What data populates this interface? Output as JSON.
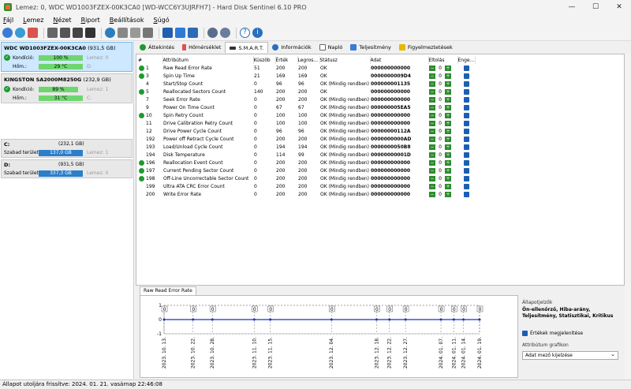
{
  "window": {
    "title": "Lemez: 0, WDC WD1003FZEX-00K3CA0 [WD-WCC6Y3UJRFH7]  -  Hard Disk Sentinel 6.10 PRO",
    "minimize": "—",
    "maximize": "☐",
    "close": "✕"
  },
  "menu": [
    "Fájl",
    "Lemez",
    "Nézet",
    "Riport",
    "Beállítások",
    "Súgó"
  ],
  "toolbar": {
    "icons": [
      "refresh-icon",
      "refresh-all-icon",
      "tools-icon",
      "hdd-icon",
      "hdd-test-icon",
      "hdd-info-icon",
      "hdd-remove-icon",
      "network-icon",
      "upload-icon",
      "print-icon",
      "copy-icon",
      "report-icon",
      "email-icon",
      "email-send-icon",
      "gear-icon",
      "gear-alt-icon",
      "help-icon",
      "info-icon"
    ]
  },
  "disks": [
    {
      "name": "WDC WD1003FZEX-00K3CA0",
      "cap": "(931,5 GB)",
      "kond_label": "Kondíció:",
      "kond": "100 %",
      "lemez": "Lemez: 0",
      "hom_label": "Hőm.:",
      "hom": "29 °C",
      "drive": "D:"
    },
    {
      "name": "KINGSTON SA2000M8250G",
      "cap": "(232,9 GB)",
      "kond_label": "Kondíció:",
      "kond": "89 %",
      "lemez": "Lemez: 1",
      "hom_label": "Hőm.:",
      "hom": "31 °C",
      "drive": "C:"
    }
  ],
  "volumes": [
    {
      "name": "C:",
      "cap": "(232,1 GB)",
      "free_label": "Szabad terület",
      "free": "137,0 GB",
      "lemez": "Lemez: 1"
    },
    {
      "name": "D:",
      "cap": "(931,5 GB)",
      "free_label": "Szabad terület",
      "free": "337,3 GB",
      "lemez": "Lemez: 0"
    }
  ],
  "tabs": [
    "Áttekintés",
    "Hőmérséklet",
    "S.M.A.R.T.",
    "Információk",
    "Napló",
    "Teljesítmény",
    "Figyelmeztetések"
  ],
  "table": {
    "headers": [
      "#",
      "Attribútum",
      "Küszöb",
      "Érték",
      "Legros...",
      "Státusz",
      "Adat",
      "Eltolás",
      "Enge..."
    ],
    "rows": [
      {
        "ok": true,
        "id": "1",
        "attr": "Raw Read Error Rate",
        "thr": "51",
        "val": "200",
        "worst": "200",
        "status": "OK",
        "data": "000000000000",
        "shift": "0"
      },
      {
        "ok": true,
        "id": "3",
        "attr": "Spin Up Time",
        "thr": "21",
        "val": "169",
        "worst": "169",
        "status": "OK",
        "data": "0000000009D4",
        "shift": "0"
      },
      {
        "ok": false,
        "id": "4",
        "attr": "Start/Stop Count",
        "thr": "0",
        "val": "96",
        "worst": "96",
        "status": "OK (Mindig rendben)",
        "data": "000000001135",
        "shift": "0"
      },
      {
        "ok": true,
        "id": "5",
        "attr": "Reallocated Sectors Count",
        "thr": "140",
        "val": "200",
        "worst": "200",
        "status": "OK",
        "data": "000000000000",
        "shift": "0"
      },
      {
        "ok": false,
        "id": "7",
        "attr": "Seek Error Rate",
        "thr": "0",
        "val": "200",
        "worst": "200",
        "status": "OK (Mindig rendben)",
        "data": "000000000000",
        "shift": "0"
      },
      {
        "ok": false,
        "id": "9",
        "attr": "Power On Time Count",
        "thr": "0",
        "val": "67",
        "worst": "67",
        "status": "OK (Mindig rendben)",
        "data": "000000005EA5",
        "shift": "0"
      },
      {
        "ok": true,
        "id": "10",
        "attr": "Spin Retry Count",
        "thr": "0",
        "val": "100",
        "worst": "100",
        "status": "OK (Mindig rendben)",
        "data": "000000000000",
        "shift": "0"
      },
      {
        "ok": false,
        "id": "11",
        "attr": "Drive Calibration Retry Count",
        "thr": "0",
        "val": "100",
        "worst": "100",
        "status": "OK (Mindig rendben)",
        "data": "000000000000",
        "shift": "0"
      },
      {
        "ok": false,
        "id": "12",
        "attr": "Drive Power Cycle Count",
        "thr": "0",
        "val": "96",
        "worst": "96",
        "status": "OK (Mindig rendben)",
        "data": "00000000112A",
        "shift": "0"
      },
      {
        "ok": false,
        "id": "192",
        "attr": "Power off Retract Cycle Count",
        "thr": "0",
        "val": "200",
        "worst": "200",
        "status": "OK (Mindig rendben)",
        "data": "0000000000AD",
        "shift": "0"
      },
      {
        "ok": false,
        "id": "193",
        "attr": "Load/Unload Cycle Count",
        "thr": "0",
        "val": "194",
        "worst": "194",
        "status": "OK (Mindig rendben)",
        "data": "0000000050B8",
        "shift": "0"
      },
      {
        "ok": false,
        "id": "194",
        "attr": "Disk Temperature",
        "thr": "0",
        "val": "114",
        "worst": "99",
        "status": "OK (Mindig rendben)",
        "data": "00000000001D",
        "shift": "0"
      },
      {
        "ok": true,
        "id": "196",
        "attr": "Reallocation Event Count",
        "thr": "0",
        "val": "200",
        "worst": "200",
        "status": "OK (Mindig rendben)",
        "data": "000000000000",
        "shift": "0"
      },
      {
        "ok": true,
        "id": "197",
        "attr": "Current Pending Sector Count",
        "thr": "0",
        "val": "200",
        "worst": "200",
        "status": "OK (Mindig rendben)",
        "data": "000000000000",
        "shift": "0"
      },
      {
        "ok": true,
        "id": "198",
        "attr": "Off-Line Uncorrectable Sector Count",
        "thr": "0",
        "val": "200",
        "worst": "200",
        "status": "OK (Mindig rendben)",
        "data": "000000000000",
        "shift": "0"
      },
      {
        "ok": false,
        "id": "199",
        "attr": "Ultra ATA CRC Error Count",
        "thr": "0",
        "val": "200",
        "worst": "200",
        "status": "OK (Mindig rendben)",
        "data": "000000000000",
        "shift": "0"
      },
      {
        "ok": false,
        "id": "200",
        "attr": "Write Error Rate",
        "thr": "0",
        "val": "200",
        "worst": "200",
        "status": "OK (Mindig rendben)",
        "data": "000000000000",
        "shift": "0"
      }
    ]
  },
  "chart": {
    "tab": "Raw Read Error Rate",
    "yticks": [
      "1",
      "0",
      "-1"
    ],
    "dates": [
      "2023. 10. 13.",
      "2023. 10. 22.",
      "2023. 10. 28.",
      "2023. 11. 10.",
      "2023. 11. 15.",
      "2023. 12. 04.",
      "2023. 12. 18.",
      "2023. 12. 22.",
      "2023. 12. 27.",
      "2024. 01. 07.",
      "2024. 01. 11.",
      "2024. 01. 14.",
      "2024. 01. 19."
    ],
    "values": [
      0,
      0,
      0,
      0,
      0,
      0,
      0,
      0,
      0,
      0,
      0,
      0,
      0
    ]
  },
  "chart_data": {
    "type": "line",
    "x": [
      "2023. 10. 13.",
      "2023. 10. 22.",
      "2023. 10. 28.",
      "2023. 11. 10.",
      "2023. 11. 15.",
      "2023. 12. 04.",
      "2023. 12. 18.",
      "2023. 12. 22.",
      "2023. 12. 27.",
      "2024. 01. 07.",
      "2024. 01. 11.",
      "2024. 01. 14.",
      "2024. 01. 19."
    ],
    "series": [
      {
        "values": [
          0,
          0,
          0,
          0,
          0,
          0,
          0,
          0,
          0,
          0,
          0,
          0,
          0
        ]
      }
    ],
    "title": "Raw Read Error Rate",
    "ylim": [
      -1,
      1
    ]
  },
  "side": {
    "state_label": "Állapotjelzők",
    "state_value": "Ön-ellenőrző, Hiba-arány, Teljesítmény, Statisztikai, Kritikus",
    "show_values": "Értékek megjelenítése",
    "graph_label": "Attribútum grafikon",
    "graph_select": "Adat mező kijelzése"
  },
  "status": "Állapot utoljára frissítve: 2024. 01. 21. vasárnap 22:46:08"
}
